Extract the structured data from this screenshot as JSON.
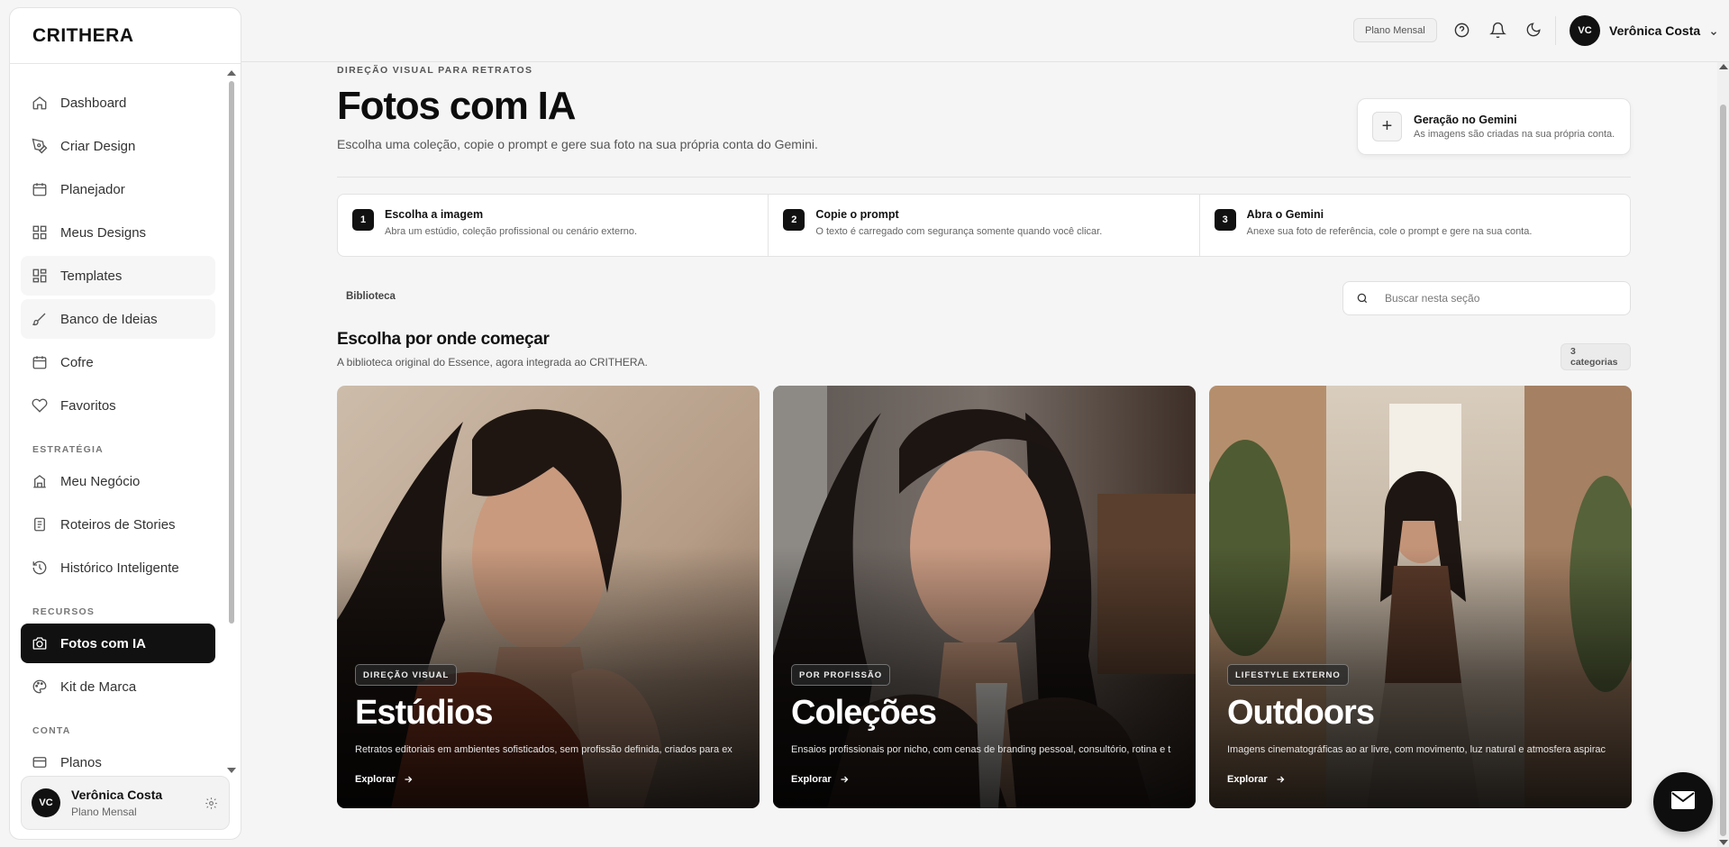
{
  "brand": "CRITHERA",
  "sidebar": {
    "items": [
      {
        "label": "Dashboard",
        "icon": "home-icon"
      },
      {
        "label": "Criar Design",
        "icon": "pen-tool-icon"
      },
      {
        "label": "Planejador",
        "icon": "calendar-icon"
      },
      {
        "label": "Meus Designs",
        "icon": "grid-icon"
      },
      {
        "label": "Templates",
        "icon": "layout-grid-icon"
      },
      {
        "label": "Banco de Ideias",
        "icon": "brush-icon"
      },
      {
        "label": "Cofre",
        "icon": "vault-icon"
      },
      {
        "label": "Favoritos",
        "icon": "heart-icon"
      }
    ],
    "section_estrategia": "ESTRATÉGIA",
    "estrategia_items": [
      {
        "label": "Meu Negócio",
        "icon": "store-icon"
      },
      {
        "label": "Roteiros de Stories",
        "icon": "document-icon"
      },
      {
        "label": "Histórico Inteligente",
        "icon": "history-icon"
      }
    ],
    "section_recursos": "RECURSOS",
    "recursos_items": [
      {
        "label": "Fotos com IA",
        "icon": "camera-icon",
        "active": true
      },
      {
        "label": "Kit de Marca",
        "icon": "palette-icon"
      }
    ],
    "section_conta": "CONTA",
    "conta_items": [
      {
        "label": "Planos",
        "icon": "card-icon"
      }
    ],
    "user": {
      "initials": "VC",
      "name": "Verônica Costa",
      "plan": "Plano Mensal"
    }
  },
  "topbar": {
    "plan_chip": "Plano Mensal",
    "user_initials": "VC",
    "user_name": "Verônica Costa"
  },
  "header": {
    "eyebrow": "DIREÇÃO VISUAL PARA RETRATOS",
    "title": "Fotos com IA",
    "subtitle": "Escolha uma coleção, copie o prompt e gere sua foto na sua própria conta do Gemini."
  },
  "gemini_card": {
    "title": "Geração no Gemini",
    "desc": "As imagens são criadas na sua própria conta."
  },
  "steps": [
    {
      "num": "1",
      "title": "Escolha a imagem",
      "desc": "Abra um estúdio, coleção profissional ou cenário externo."
    },
    {
      "num": "2",
      "title": "Copie o prompt",
      "desc": "O texto é carregado com segurança somente quando você clicar."
    },
    {
      "num": "3",
      "title": "Abra o Gemini",
      "desc": "Anexe sua foto de referência, cole o prompt e gere na sua conta."
    }
  ],
  "library": {
    "tab": "Biblioteca",
    "search_placeholder": "Buscar nesta seção",
    "section_title": "Escolha por onde começar",
    "section_sub": "A biblioteca original do Essence, agora integrada ao CRITHERA.",
    "count": "3 categorias"
  },
  "cards": [
    {
      "tag": "DIREÇÃO VISUAL",
      "title": "Estúdios",
      "desc": "Retratos editoriais em ambientes sofisticados, sem profissão definida, criados para ex",
      "cta": "Explorar"
    },
    {
      "tag": "POR PROFISSÃO",
      "title": "Coleções",
      "desc": "Ensaios profissionais por nicho, com cenas de branding pessoal, consultório, rotina e t",
      "cta": "Explorar"
    },
    {
      "tag": "LIFESTYLE EXTERNO",
      "title": "Outdoors",
      "desc": "Imagens cinematográficas ao ar livre, com movimento, luz natural e atmosfera aspirac",
      "cta": "Explorar"
    }
  ],
  "colors": {
    "accent": "#111111",
    "background": "#f5f5f5"
  }
}
